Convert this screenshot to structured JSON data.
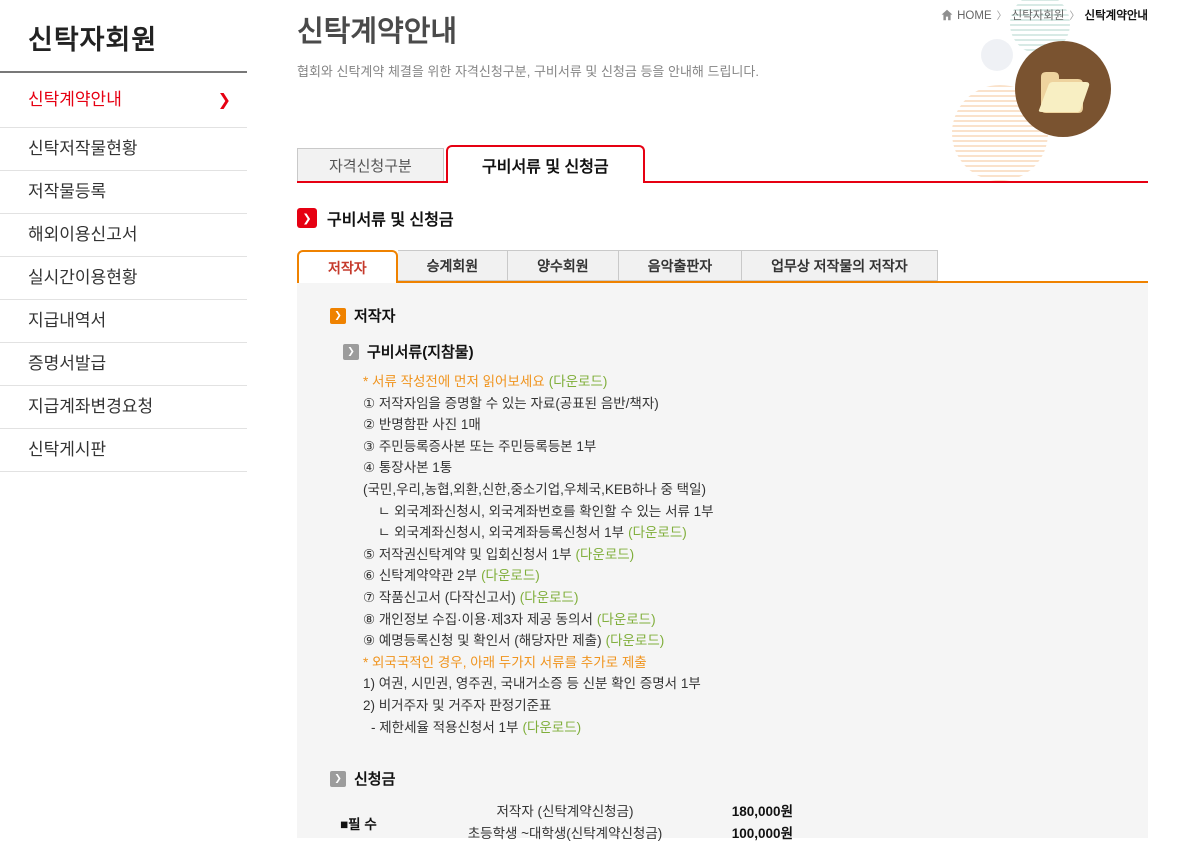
{
  "colors": {
    "red": "#e60012",
    "orange": "#ef8200",
    "orange_text": "#c5392b",
    "green": "#7fae3a",
    "note_orange": "#f0941e",
    "brown": "#7a5330",
    "panel_bg": "#f5f5f5"
  },
  "sidebar": {
    "title": "신탁자회원",
    "items": [
      {
        "label": "신탁계약안내",
        "active": true
      },
      {
        "label": "신탁저작물현황",
        "active": false
      },
      {
        "label": "저작물등록",
        "active": false
      },
      {
        "label": "해외이용신고서",
        "active": false
      },
      {
        "label": "실시간이용현황",
        "active": false
      },
      {
        "label": "지급내역서",
        "active": false
      },
      {
        "label": "증명서발급",
        "active": false
      },
      {
        "label": "지급계좌변경요청",
        "active": false
      },
      {
        "label": "신탁게시판",
        "active": false
      }
    ]
  },
  "breadcrumb": {
    "items": [
      "HOME",
      "신탁자회원",
      "신탁계약안내"
    ]
  },
  "header": {
    "title": "신탁계약안내",
    "description": "협회와 신탁계약 체결을 위한 자격신청구분, 구비서류 및 신청금 등을 안내해 드립니다.",
    "illustration": "open-folder-icon"
  },
  "tabs": [
    {
      "label": "자격신청구분",
      "active": false
    },
    {
      "label": "구비서류 및 신청금",
      "active": true
    }
  ],
  "section_title": "구비서류 및 신청금",
  "subtabs": [
    {
      "label": "저작자",
      "active": true
    },
    {
      "label": "승계회원",
      "active": false
    },
    {
      "label": "양수회원",
      "active": false
    },
    {
      "label": "음악출판자",
      "active": false
    },
    {
      "label": "업무상 저작물의 저작자",
      "active": false
    }
  ],
  "content": {
    "heading": "저작자",
    "documents_heading": "구비서류(지참물)",
    "lines": [
      {
        "type": "note",
        "text": "* 서류 작성전에 먼저 읽어보세요",
        "link": "(다운로드)"
      },
      {
        "type": "item",
        "text": "① 저작자임을 증명할 수 있는 자료(공표된 음반/책자)"
      },
      {
        "type": "item",
        "text": "② 반명함판 사진 1매"
      },
      {
        "type": "item",
        "text": "③ 주민등록증사본 또는 주민등록등본 1부"
      },
      {
        "type": "item",
        "text": "④ 통장사본 1통"
      },
      {
        "type": "item",
        "text": "(국민,우리,농협,외환,신한,중소기업,우체국,KEB하나 중 택일)"
      },
      {
        "type": "sub",
        "text": "ㄴ 외국계좌신청시, 외국계좌번호를 확인할 수 있는 서류 1부"
      },
      {
        "type": "sub",
        "text": "ㄴ 외국계좌신청시, 외국계좌등록신청서 1부",
        "link": "(다운로드)"
      },
      {
        "type": "item",
        "text": "⑤ 저작권신탁계약 및 입회신청서 1부",
        "link": "(다운로드)"
      },
      {
        "type": "item",
        "text": "⑥ 신탁계약약관 2부",
        "link": "(다운로드)"
      },
      {
        "type": "item",
        "text": "⑦ 작품신고서 (다작신고서)",
        "link": "(다운로드)"
      },
      {
        "type": "item",
        "text": "⑧ 개인정보 수집·이용·제3자 제공 동의서",
        "link": "(다운로드)"
      },
      {
        "type": "item",
        "text": "⑨ 예명등록신청 및 확인서 (해당자만 제출)",
        "link": "(다운로드)"
      },
      {
        "type": "note",
        "text": "* 외국국적인 경우, 아래 두가지 서류를 추가로 제출"
      },
      {
        "type": "item",
        "text": "1) 여권, 시민권, 영주권, 국내거소증 등 신분 확인 증명서 1부"
      },
      {
        "type": "item",
        "text": "2) 비거주자 및 거주자 판정기준표"
      },
      {
        "type": "sub2",
        "text": "- 제한세율 적용신청서 1부",
        "link": "(다운로드)"
      }
    ],
    "fees": {
      "heading": "신청금",
      "required_label": "■필 수",
      "rows": [
        {
          "label": "저작자 (신탁계약신청금)",
          "value": "180,000원"
        },
        {
          "label": "초등학생 ~대학생(신탁계약신청금)",
          "value": "100,000원"
        }
      ]
    }
  }
}
